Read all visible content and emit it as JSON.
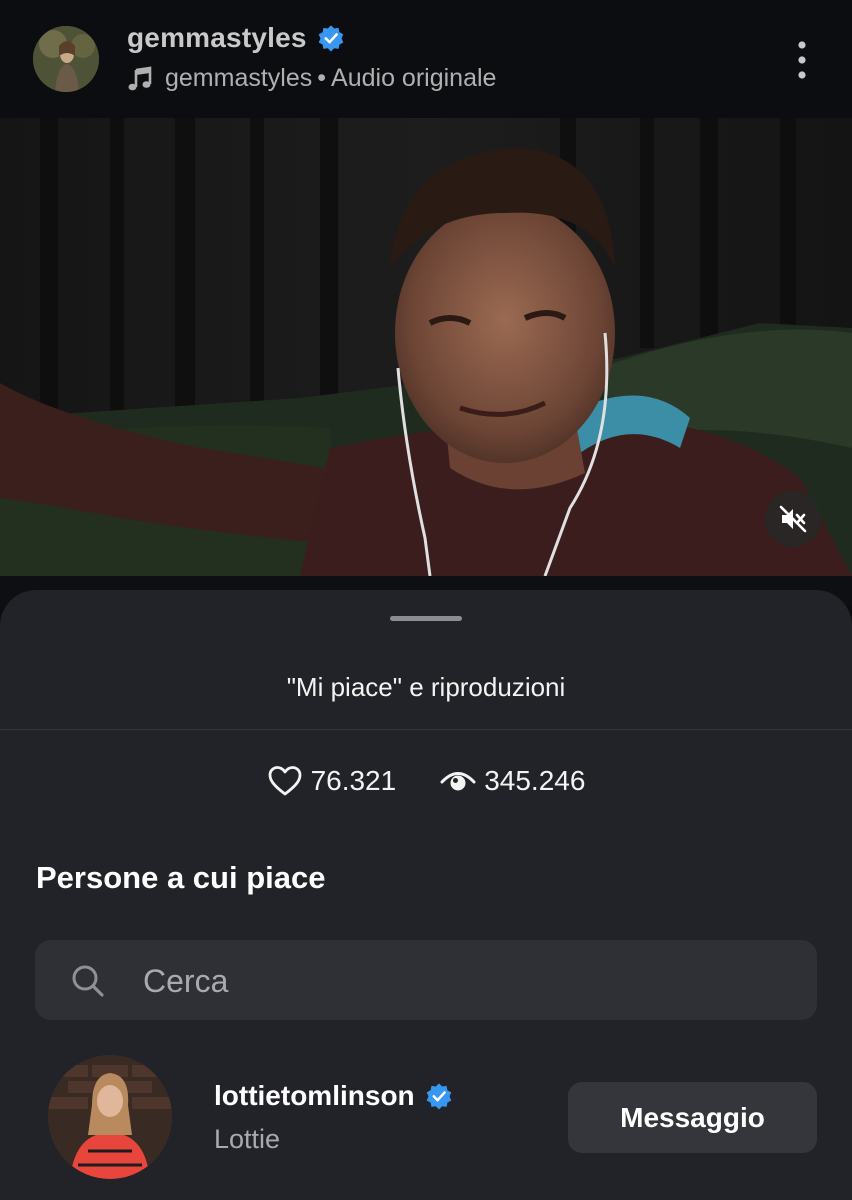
{
  "header": {
    "username": "gemmastyles",
    "audio_owner": "gemmastyles",
    "audio_separator": "•",
    "audio_label": "Audio originale",
    "icons": {
      "verified": "verified-badge-icon",
      "music": "music-note-icon",
      "more": "more-vertical-icon"
    }
  },
  "video": {
    "muted": true,
    "mute_icon": "speaker-muted-icon"
  },
  "sheet": {
    "title": "\"Mi piace\" e riproduzioni",
    "likes_count": "76.321",
    "plays_count": "345.246",
    "section_title": "Persone a cui piace",
    "search": {
      "placeholder": "Cerca",
      "value": ""
    }
  },
  "liker": {
    "username": "lottietomlinson",
    "name": "Lottie",
    "message_label": "Messaggio"
  },
  "colors": {
    "background": "#0c0d10",
    "sheet": "#212328",
    "search_bg": "#2e3036",
    "button_bg": "#34363c",
    "verified_blue": "#3897f0"
  }
}
